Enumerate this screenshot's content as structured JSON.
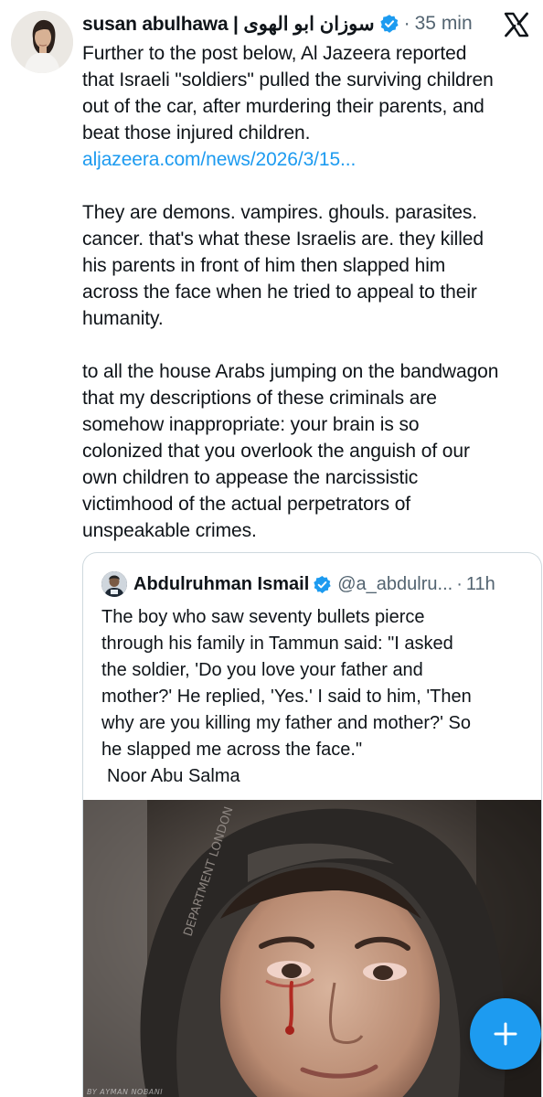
{
  "post": {
    "author": {
      "display_name": "susan abulhawa | سوزان ابو الهوى",
      "verified": true
    },
    "separator": "·",
    "time": "35 min",
    "paragraphs": [
      {
        "lines": [
          "Further to the post below, Al Jazeera reported",
          "that Israeli \"soldiers\" pulled the surviving children",
          "out of the car, after murdering their parents, and",
          "beat those injured children."
        ],
        "link": "aljazeera.com/news/2026/3/15..."
      },
      {
        "lines": [
          "They are demons. vampires. ghouls. parasites.",
          "cancer. that's what these Israelis are. they killed",
          "his parents in front of him then slapped him",
          "across the face when he tried to appeal to their",
          "humanity."
        ]
      },
      {
        "lines": [
          "to all the house Arabs jumping on the bandwagon",
          "that my descriptions of these criminals are",
          "somehow inappropriate: your brain is so",
          "colonized that you overlook the anguish of our",
          "own children to appease the narcissistic",
          "victimhood of the actual perpetrators of",
          "unspeakable crimes."
        ]
      }
    ]
  },
  "quoted_post": {
    "author": {
      "display_name": "Abdulruhman Ismail",
      "handle": "@a_abdulru...",
      "verified": true
    },
    "separator": "·",
    "time": "11h",
    "lines": [
      "The boy who saw seventy bullets pierce",
      "through his family in Tammun said: \"I asked",
      "the soldier, 'Do you love your father and",
      "mother?' He replied, 'Yes.' I said to him, 'Then",
      "why are you killing my father and mother?' So",
      "he slapped me across the face.\""
    ],
    "signature": "Noor Abu Salma",
    "media": {
      "watermark": "BY AYMAN NOBANI"
    }
  },
  "icons": {
    "logo": "x-logo-icon",
    "verified": "verified-badge-icon",
    "compose": "plus-icon"
  },
  "colors": {
    "link": "#1d9bf0",
    "secondary_text": "#536471",
    "verified": "#1d9bf0",
    "fab": "#1d9bf0",
    "border": "#cfd9de"
  }
}
